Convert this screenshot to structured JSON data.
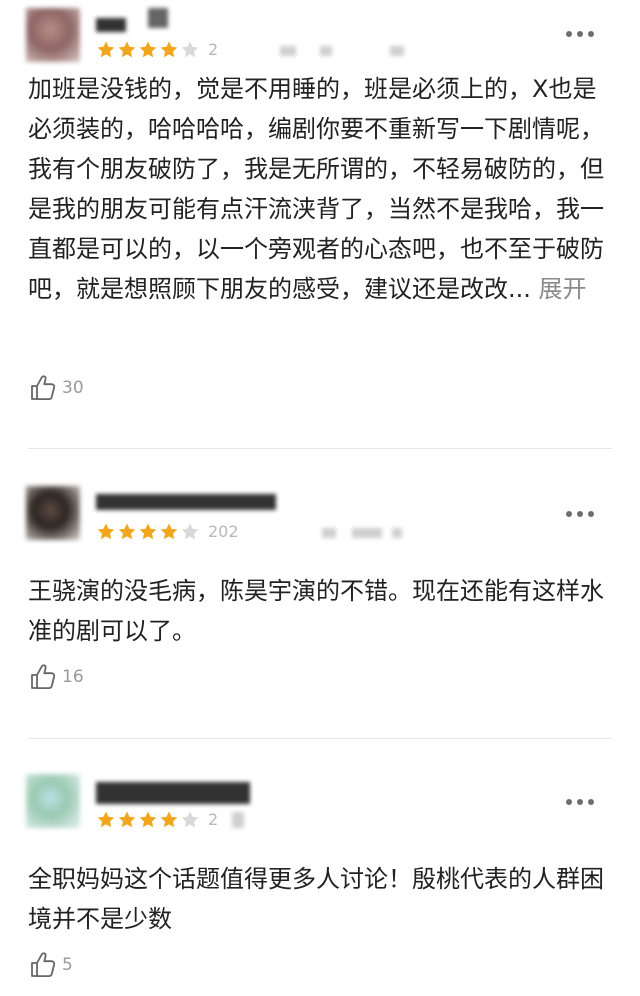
{
  "colors": {
    "star": "#f2a61e",
    "star_empty": "#d9d9d9",
    "text": "#222222",
    "muted": "#9a9a9a",
    "divider": "#e6e6e6"
  },
  "reviews": [
    {
      "rating": 4,
      "date_fragment": "2",
      "content": "加班是没钱的，觉是不用睡的，班是必须上的，X也是必须装的，哈哈哈哈，编剧你要不重新写一下剧情呢，我有个朋友破防了，我是无所谓的，不轻易破防的，但是我的朋友可能有点汗流浃背了，当然不是我哈，我一直都是可以的，以一个旁观者的心态吧，也不至于破防吧，就是想照顾下朋友的感受，建议还是改改...",
      "expand_label": "展开",
      "likes": "30"
    },
    {
      "rating": 4,
      "date_fragment": "202",
      "content": "王骁演的没毛病，陈昊宇演的不错。现在还能有这样水准的剧可以了。",
      "likes": "16"
    },
    {
      "rating": 4,
      "date_fragment": "2",
      "content": "全职妈妈这个话题值得更多人讨论！殷桃代表的人群困境并不是少数",
      "likes": "5"
    }
  ],
  "icons": {
    "more": "more-dots-icon",
    "like": "thumbs-up-icon",
    "star": "star-icon"
  }
}
